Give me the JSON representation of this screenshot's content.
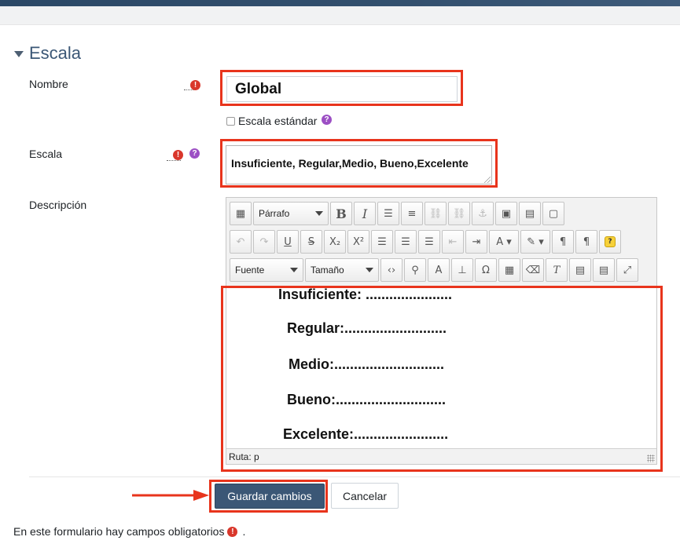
{
  "section": {
    "title": "Escala"
  },
  "fields": {
    "nombre": {
      "label": "Nombre",
      "value": "Global",
      "required_icon": "!"
    },
    "escala_estandar": {
      "label": "Escala estándar",
      "checked": false,
      "help_icon": "?"
    },
    "escala": {
      "label": "Escala",
      "value": "Insuficiente, Regular,Medio, Bueno,Excelente",
      "required_icon": "!",
      "help_icon": "?"
    },
    "descripcion": {
      "label": "Descripción"
    }
  },
  "editor": {
    "format_select": "Párrafo",
    "font_select": "Fuente",
    "size_select": "Tamaño",
    "content_lines": [
      "Insuficiente: ......................",
      "Regular:..........................",
      "Medio:............................",
      "Bueno:............................",
      "Excelente:........................"
    ],
    "status_path": "Ruta: p",
    "help_badge": "?"
  },
  "buttons": {
    "save": "Guardar cambios",
    "cancel": "Cancelar"
  },
  "footer": {
    "note": "En este formulario hay campos obligatorios",
    "note_end": ".",
    "required_icon": "!"
  },
  "colors": {
    "highlight": "#e8341c",
    "primary": "#3b5776",
    "required": "#d9372b",
    "help": "#9c4fc4"
  }
}
